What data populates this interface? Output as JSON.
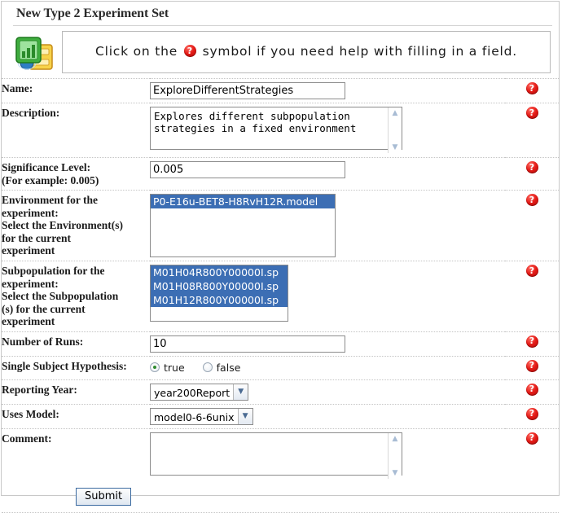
{
  "header": {
    "title": "New Type 2 Experiment Set",
    "app_icon": "chart-document-icon"
  },
  "banner": {
    "text_before": "Click on the",
    "icon": "help-question-icon",
    "text_after": "symbol if you need help with filling in a field."
  },
  "form": {
    "fields": [
      {
        "label": "Name:",
        "type": "text",
        "value": "ExploreDifferentStrategies",
        "help": "help-question-icon"
      },
      {
        "label": "Description:",
        "type": "textarea",
        "value": "Explores different subpopulation strategies in a fixed environment",
        "help": "help-question-icon"
      },
      {
        "label_line1": "Significance Level:",
        "label_line2": "(For example: 0.005)",
        "type": "text",
        "value": "0.005",
        "help": "help-question-icon"
      },
      {
        "label_line1": "Environment for the",
        "label_line2": "experiment:",
        "label_line3": "Select the Environment(s)",
        "label_line4": "for the current",
        "label_line5": "experiment",
        "type": "listbox",
        "options": [
          {
            "text": "P0-E16u-BET8-H8RvH12R.model",
            "selected": true
          }
        ],
        "help": "help-question-icon"
      },
      {
        "label_line1": "Subpopulation for the",
        "label_line2": "experiment:",
        "label_line3": "Select the Subpopulation",
        "label_line4": "(s) for the current",
        "label_line5": "experiment",
        "type": "listbox",
        "options": [
          {
            "text": "M01H04R800Y00000I.sp",
            "selected": true
          },
          {
            "text": "M01H08R800Y00000I.sp",
            "selected": true
          },
          {
            "text": "M01H12R800Y00000I.sp",
            "selected": true
          }
        ],
        "help": "help-question-icon"
      },
      {
        "label": "Number of Runs:",
        "type": "text",
        "value": "10",
        "help": "help-question-icon"
      },
      {
        "label": "Single Subject Hypothesis:",
        "type": "radio",
        "options": [
          {
            "label": "true",
            "checked": true
          },
          {
            "label": "false",
            "checked": false
          }
        ],
        "help": "help-question-icon"
      },
      {
        "label": "Reporting Year:",
        "type": "select",
        "value": "year200Report",
        "help": "help-question-icon"
      },
      {
        "label": "Uses Model:",
        "type": "select",
        "value": "model0-6-6unix",
        "help": "help-question-icon"
      },
      {
        "label": "Comment:",
        "type": "textarea",
        "value": "",
        "help": "help-question-icon"
      }
    ],
    "submit_label": "Submit"
  },
  "colors": {
    "help_icon_red": "#e41b17",
    "selection_blue": "#3c6eb4",
    "radio_green": "#2f8a2f",
    "button_border": "#3b6aa0"
  }
}
